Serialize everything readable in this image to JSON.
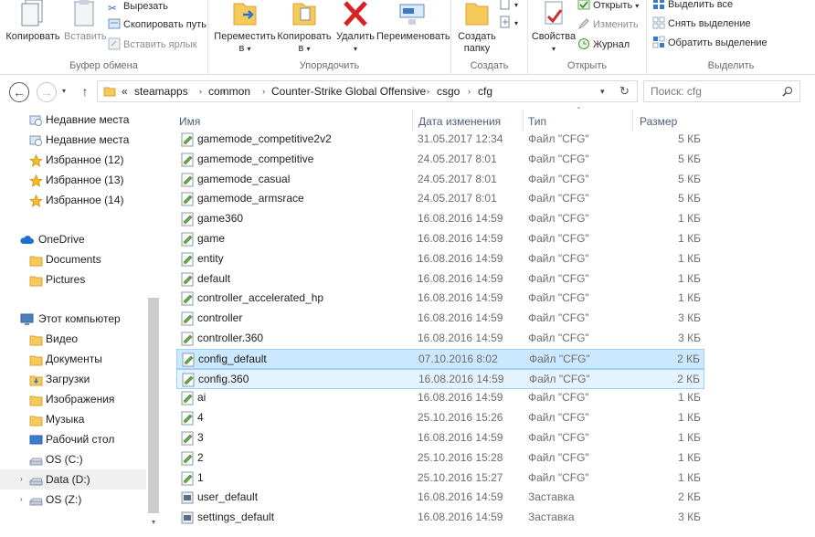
{
  "ribbon": {
    "clipboard": {
      "label": "Буфер обмена",
      "copy": "Копировать",
      "paste": "Вставить",
      "cut": "Вырезать",
      "copy_path": "Скопировать путь",
      "paste_shortcut": "Вставить ярлык"
    },
    "organize": {
      "label": "Упорядочить",
      "move_to_1": "Переместить",
      "move_to_2": "в",
      "copy_to_1": "Копировать",
      "copy_to_2": "в",
      "delete": "Удалить",
      "rename": "Переименовать"
    },
    "new": {
      "label": "Создать",
      "new_folder_1": "Создать",
      "new_folder_2": "папку"
    },
    "open": {
      "label": "Открыть",
      "properties": "Свойства",
      "open": "Открыть",
      "edit": "Изменить",
      "history": "Журнал"
    },
    "select": {
      "label": "Выделить",
      "select_all": "Выделить все",
      "select_none": "Снять выделение",
      "invert": "Обратить выделение"
    }
  },
  "address": {
    "overflow": "«",
    "crumbs": [
      "steamapps",
      "common",
      "Counter-Strike Global Offensive",
      "csgo",
      "cfg"
    ],
    "search_placeholder": "Поиск: cfg"
  },
  "nav": [
    {
      "label": "Недавние места",
      "icon": "recent-places-icon"
    },
    {
      "label": "Недавние места",
      "icon": "recent-places-icon"
    },
    {
      "label": "Избранное (12)",
      "icon": "star-icon"
    },
    {
      "label": "Избранное (13)",
      "icon": "star-icon"
    },
    {
      "label": "Избранное (14)",
      "icon": "star-icon"
    },
    {
      "label": "OneDrive",
      "icon": "cloud-icon"
    },
    {
      "label": "Documents",
      "icon": "folder-icon"
    },
    {
      "label": "Pictures",
      "icon": "folder-icon"
    },
    {
      "label": "Этот компьютер",
      "icon": "computer-icon"
    },
    {
      "label": "Видео",
      "icon": "video-folder-icon"
    },
    {
      "label": "Документы",
      "icon": "documents-folder-icon"
    },
    {
      "label": "Загрузки",
      "icon": "downloads-folder-icon"
    },
    {
      "label": "Изображения",
      "icon": "pictures-folder-icon"
    },
    {
      "label": "Музыка",
      "icon": "music-folder-icon"
    },
    {
      "label": "Рабочий стол",
      "icon": "desktop-folder-icon"
    },
    {
      "label": "OS (C:)",
      "icon": "drive-icon"
    },
    {
      "label": "Data (D:)",
      "icon": "drive-icon"
    },
    {
      "label": "OS (Z:)",
      "icon": "drive-icon"
    }
  ],
  "columns": {
    "name": "Имя",
    "date": "Дата изменения",
    "type": "Тип",
    "size": "Размер"
  },
  "files": [
    {
      "name": "gamemode_competitive2v2",
      "date": "31.05.2017 12:34",
      "type": "Файл \"CFG\"",
      "size": "5 КБ"
    },
    {
      "name": "gamemode_competitive",
      "date": "24.05.2017 8:01",
      "type": "Файл \"CFG\"",
      "size": "5 КБ"
    },
    {
      "name": "gamemode_casual",
      "date": "24.05.2017 8:01",
      "type": "Файл \"CFG\"",
      "size": "5 КБ"
    },
    {
      "name": "gamemode_armsrace",
      "date": "24.05.2017 8:01",
      "type": "Файл \"CFG\"",
      "size": "5 КБ"
    },
    {
      "name": "game360",
      "date": "16.08.2016 14:59",
      "type": "Файл \"CFG\"",
      "size": "1 КБ"
    },
    {
      "name": "game",
      "date": "16.08.2016 14:59",
      "type": "Файл \"CFG\"",
      "size": "1 КБ"
    },
    {
      "name": "entity",
      "date": "16.08.2016 14:59",
      "type": "Файл \"CFG\"",
      "size": "1 КБ"
    },
    {
      "name": "default",
      "date": "16.08.2016 14:59",
      "type": "Файл \"CFG\"",
      "size": "1 КБ"
    },
    {
      "name": "controller_accelerated_hp",
      "date": "16.08.2016 14:59",
      "type": "Файл \"CFG\"",
      "size": "1 КБ"
    },
    {
      "name": "controller",
      "date": "16.08.2016 14:59",
      "type": "Файл \"CFG\"",
      "size": "3 КБ"
    },
    {
      "name": "controller.360",
      "date": "16.08.2016 14:59",
      "type": "Файл \"CFG\"",
      "size": "3 КБ"
    },
    {
      "name": "config_default",
      "date": "07.10.2016 8:02",
      "type": "Файл \"CFG\"",
      "size": "2 КБ"
    },
    {
      "name": "config.360",
      "date": "16.08.2016 14:59",
      "type": "Файл \"CFG\"",
      "size": "2 КБ"
    },
    {
      "name": "ai",
      "date": "16.08.2016 14:59",
      "type": "Файл \"CFG\"",
      "size": "1 КБ"
    },
    {
      "name": "4",
      "date": "25.10.2016 15:26",
      "type": "Файл \"CFG\"",
      "size": "1 КБ"
    },
    {
      "name": "3",
      "date": "16.08.2016 14:59",
      "type": "Файл \"CFG\"",
      "size": "1 КБ"
    },
    {
      "name": "2",
      "date": "25.10.2016 15:28",
      "type": "Файл \"CFG\"",
      "size": "1 КБ"
    },
    {
      "name": "1",
      "date": "25.10.2016 15:27",
      "type": "Файл \"CFG\"",
      "size": "1 КБ"
    },
    {
      "name": "user_default",
      "date": "16.08.2016 14:59",
      "type": "Заставка",
      "size": "2 КБ"
    },
    {
      "name": "settings_default",
      "date": "16.08.2016 14:59",
      "type": "Заставка",
      "size": "3 КБ"
    }
  ],
  "colors": {
    "selection_bg": "#cce8ff",
    "selection_border": "#99d1ff",
    "header_text": "#4c607a",
    "cfg_icon_green": "#6aa84f"
  }
}
